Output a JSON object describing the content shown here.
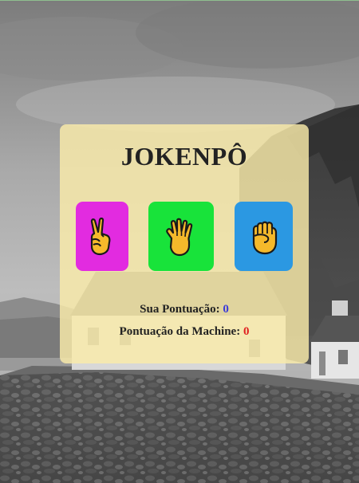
{
  "game": {
    "title": "JOKENPÔ",
    "choices": [
      {
        "name": "scissors",
        "icon": "victory-hand-icon",
        "color": "#e22be0"
      },
      {
        "name": "paper",
        "icon": "raised-hand-icon",
        "color": "#18e33a"
      },
      {
        "name": "rock",
        "icon": "raised-fist-icon",
        "color": "#2b98e2"
      }
    ],
    "score": {
      "player_label": "Sua Pontuação:",
      "player_value": "0",
      "player_color": "#3a3ad8",
      "machine_label": "Pontuação da Machine:",
      "machine_value": "0",
      "machine_color": "#e02020"
    }
  }
}
